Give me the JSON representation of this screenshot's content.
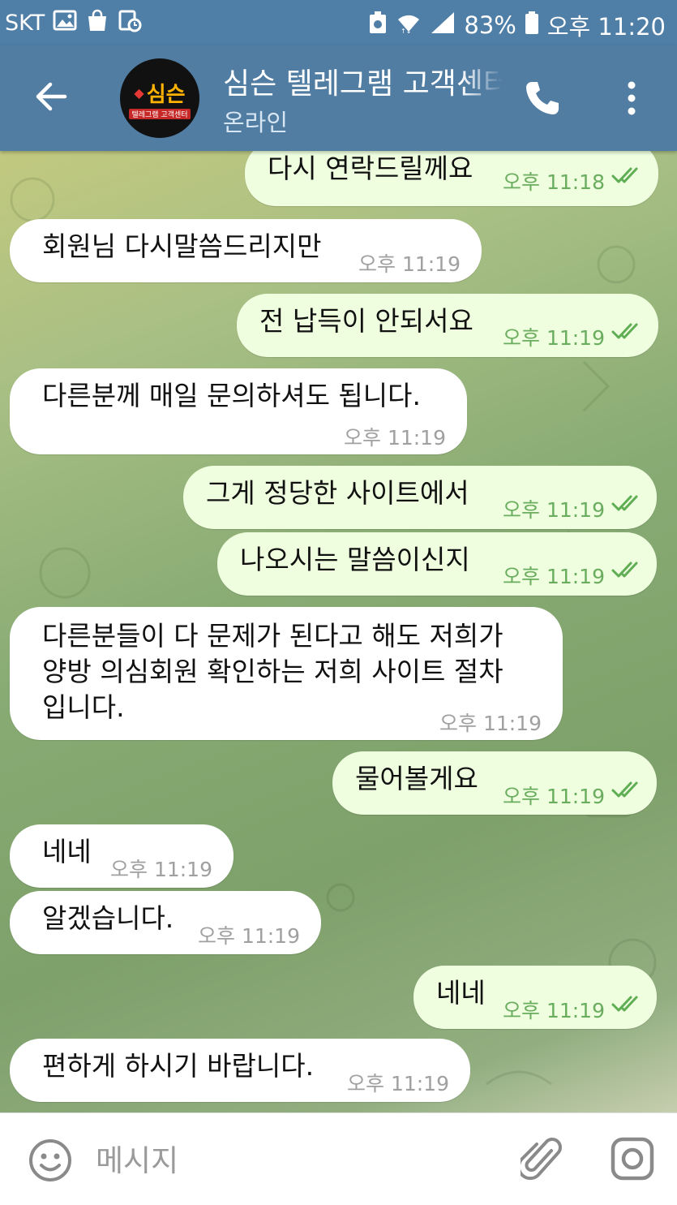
{
  "status_bar": {
    "carrier": "SKT",
    "battery": "83%",
    "time": "오후 11:20"
  },
  "header": {
    "title": "심슨 텔레그램 고객센터",
    "status": "온라인",
    "avatar_logo": "심슨",
    "avatar_sub": "텔레그램 고객센터"
  },
  "messages": [
    {
      "direction": "out",
      "text": "다시 연락드릴께요",
      "time": "오후 11:18",
      "read": true
    },
    {
      "direction": "in",
      "text": "회원님 다시말씀드리지만",
      "time": "오후 11:19"
    },
    {
      "direction": "out",
      "text": "전 납득이 안되서요",
      "time": "오후 11:19",
      "read": true
    },
    {
      "direction": "in",
      "text": "다른분께 매일 문의하셔도 됩니다.",
      "time": "오후 11:19"
    },
    {
      "direction": "out",
      "text": "그게 정당한 사이트에서",
      "time": "오후 11:19",
      "read": true
    },
    {
      "direction": "out",
      "text": "나오시는 말씀이신지",
      "time": "오후 11:19",
      "read": true
    },
    {
      "direction": "in",
      "lines": [
        "다른분들이 다 문제가 된다고 해도 저희가",
        "양방 의심회원 확인하는 저희 사이트 절차",
        "입니다."
      ],
      "time": "오후 11:19"
    },
    {
      "direction": "out",
      "text": "물어볼게요",
      "time": "오후 11:19",
      "read": true
    },
    {
      "direction": "in",
      "text": "네네",
      "time": "오후 11:19"
    },
    {
      "direction": "in",
      "text": "알겠습니다.",
      "time": "오후 11:19"
    },
    {
      "direction": "out",
      "text": "네네",
      "time": "오후 11:19",
      "read": true
    },
    {
      "direction": "in",
      "text": "편하게 하시기 바랍니다.",
      "time": "오후 11:19"
    }
  ],
  "input": {
    "placeholder": "메시지"
  },
  "colors": {
    "header": "#527da3",
    "outgoing_bubble": "#eefedf",
    "incoming_bubble": "#ffffff",
    "time_outgoing": "#6aad5e",
    "time_incoming": "#a0a0a0"
  }
}
